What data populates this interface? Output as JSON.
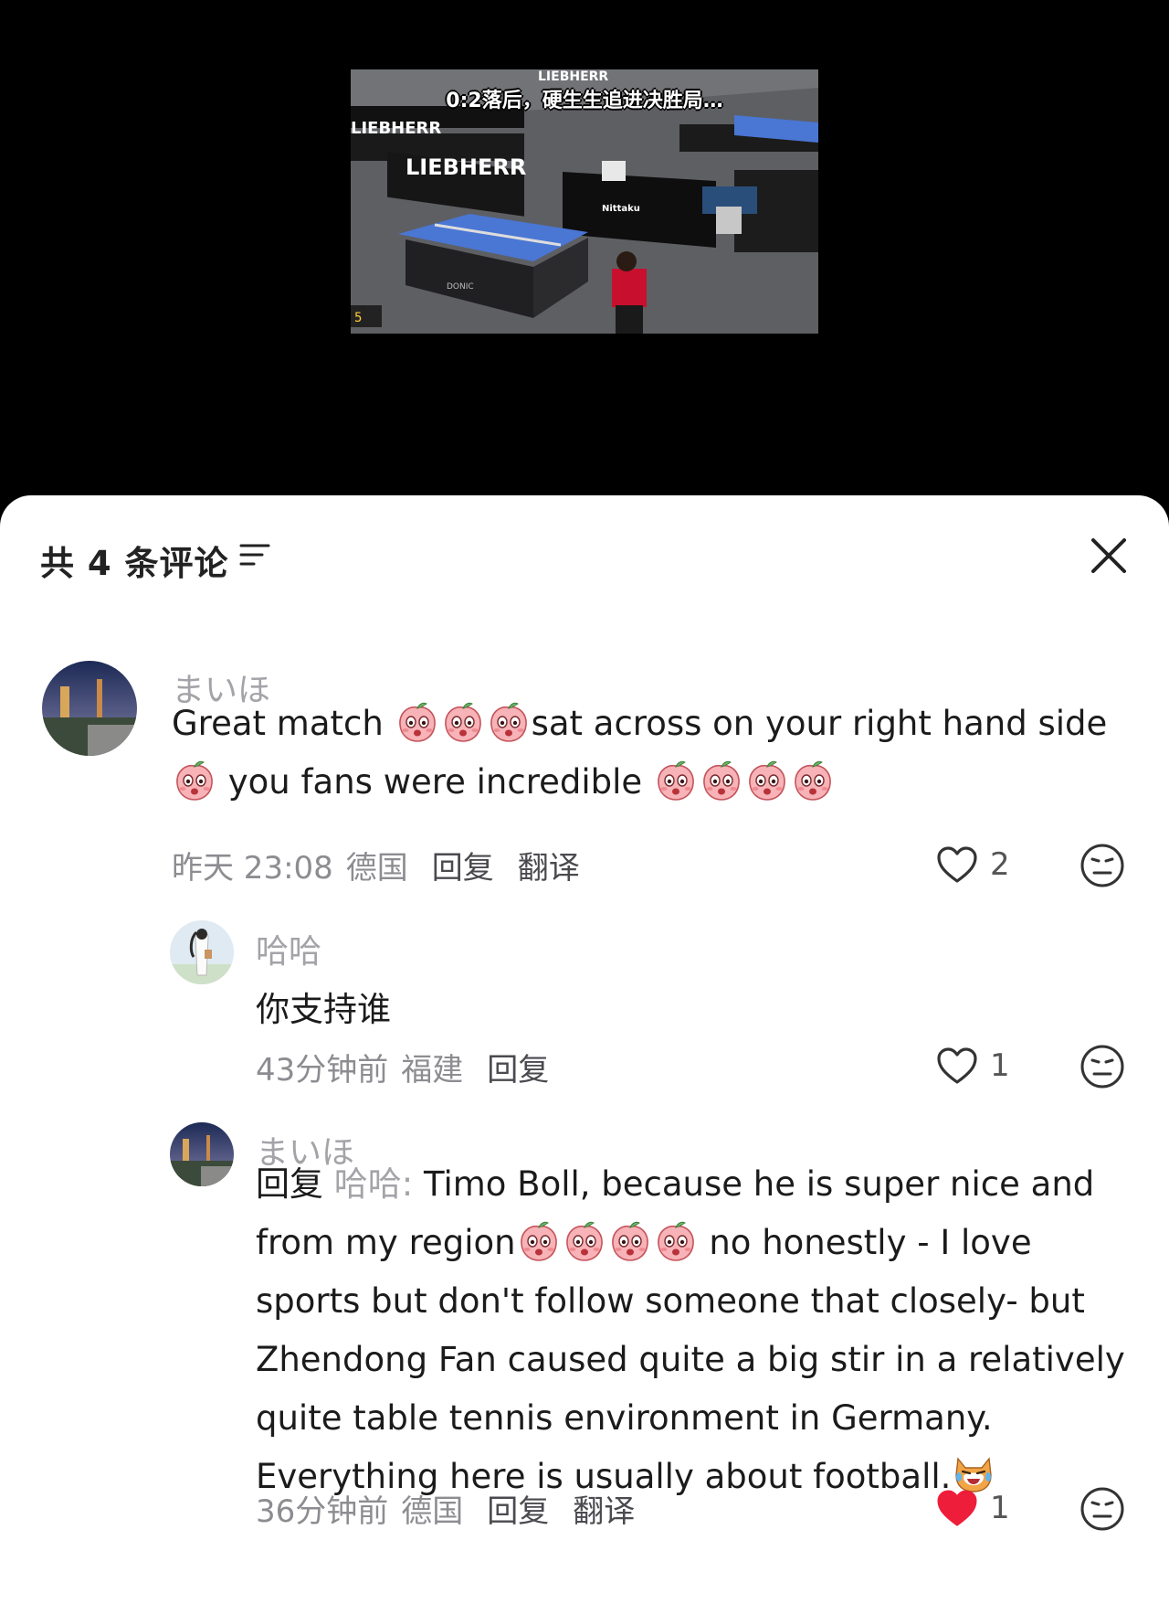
{
  "video": {
    "caption": "0:2落后，硬生生追进决胜局",
    "caption_suffix": "…",
    "banner_text_1": "LIEBHERR",
    "banner_text_2": "LIEBHERR",
    "banner_text_3": "LIEBHERR",
    "sponsor_1": "DONIC",
    "sponsor_2": "Nittaku",
    "scoreboard": "5"
  },
  "header": {
    "comment_count": "共 4 条评论",
    "sort_icon": "filter-lines-icon",
    "close_icon": "close-x-icon"
  },
  "comments": [
    {
      "username": "まいほ",
      "text_part1": "Great match ",
      "text_part2": "sat across on your right hand side ",
      "text_part3": " you fans were incredible ",
      "time": "昨天 23:08",
      "location": "德国",
      "reply_label": "回复",
      "translate_label": "翻译",
      "likes": "2",
      "liked": false
    },
    {
      "username": "哈哈",
      "text": "你支持谁",
      "time": "43分钟前",
      "location": "福建",
      "reply_label": "回复",
      "likes": "1",
      "liked": false
    },
    {
      "username": "まいほ",
      "reply_prefix": "回复 ",
      "mention": "哈哈:",
      "text_part1": " Timo Boll, because he is super nice and from my region",
      "text_part2": " no honestly - I love sports but don't follow someone that closely- but Zhendong Fan caused quite a big stir in a relatively quite table tennis environment in Germany. Everything here is usually about football.",
      "time": "36分钟前",
      "location": "德国",
      "reply_label": "回复",
      "translate_label": "翻译",
      "likes": "1",
      "liked": true
    }
  ],
  "colors": {
    "like_active": "#ee1d3a",
    "muted_text": "#a3a3a8",
    "table_blue": "#4a76d4"
  }
}
